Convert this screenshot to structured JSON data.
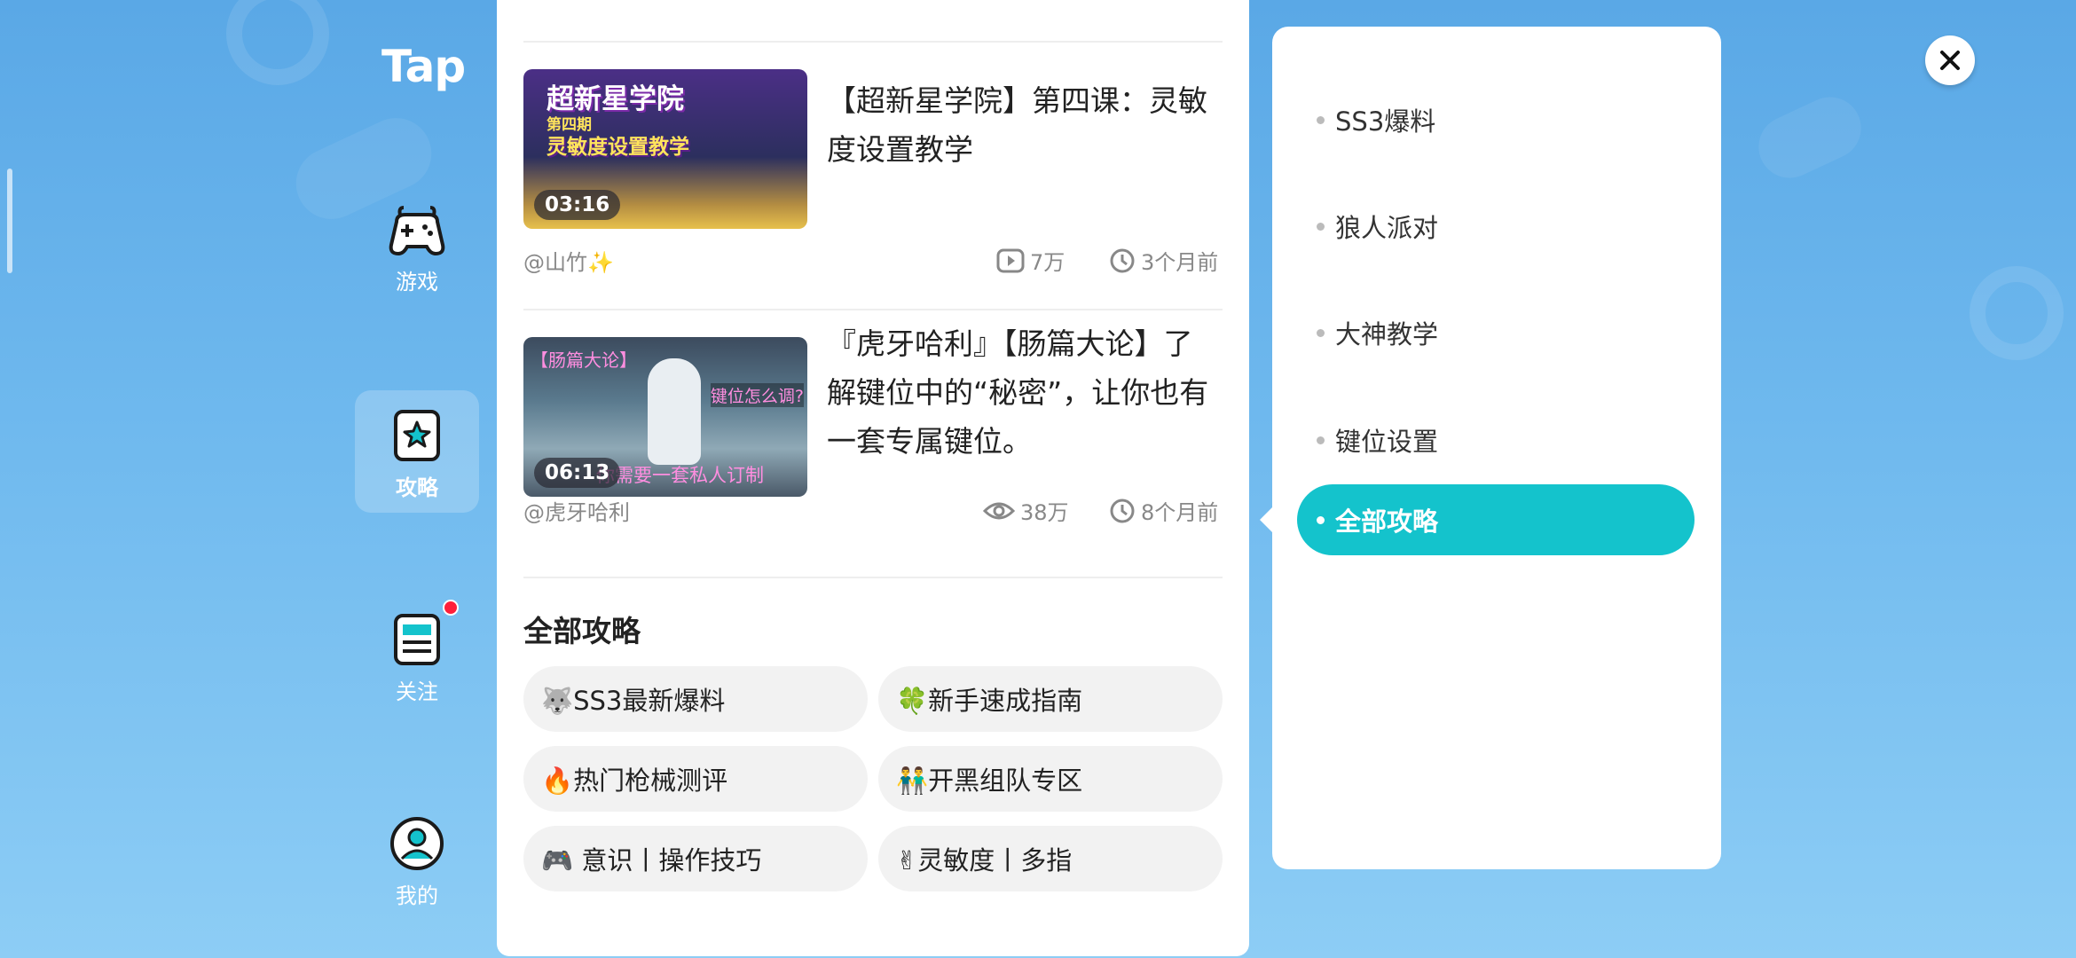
{
  "app": {
    "logo": "Tap"
  },
  "nav": {
    "items": [
      {
        "label": "游戏",
        "icon": "gamepad-icon"
      },
      {
        "label": "攻略",
        "icon": "star-card-icon",
        "active": true
      },
      {
        "label": "关注",
        "icon": "feed-icon",
        "badge": true
      },
      {
        "label": "我的",
        "icon": "user-icon"
      }
    ]
  },
  "feed": {
    "videos": [
      {
        "title": "【超新星学院】第四课：灵敏度设置教学",
        "duration": "03:16",
        "author": "@山竹✨",
        "views": "7万",
        "views_icon": "play-icon",
        "time": "3个月前",
        "thumb_text_1": "超新星学院",
        "thumb_text_2": "第四期",
        "thumb_text_3": "灵敏度设置教学"
      },
      {
        "title": "『虎牙哈利』【肠篇大论】了解键位中的“秘密”，让你也有一套专属键位。",
        "duration": "06:13",
        "author": "@虎牙哈利",
        "views": "38万",
        "views_icon": "eye-icon",
        "time": "8个月前",
        "thumb_text_1": "【肠篇大论】",
        "thumb_text_2": "键位怎么调?",
        "thumb_text_3": "你需要一套私人订制"
      }
    ],
    "section_title": "全部攻略",
    "chips": [
      "🐺SS3最新爆料",
      "🍀新手速成指南",
      "🔥热门枪械测评",
      "👬开黑组队专区",
      "🎮 意识丨操作技巧",
      "✌灵敏度丨多指"
    ]
  },
  "side_menu": {
    "items": [
      "SS3爆料",
      "狼人派对",
      "大神教学",
      "键位设置"
    ],
    "active": "全部攻略"
  },
  "colors": {
    "accent": "#14c3cc",
    "background": "#6fb9ee",
    "badge": "#ff1f3a"
  }
}
